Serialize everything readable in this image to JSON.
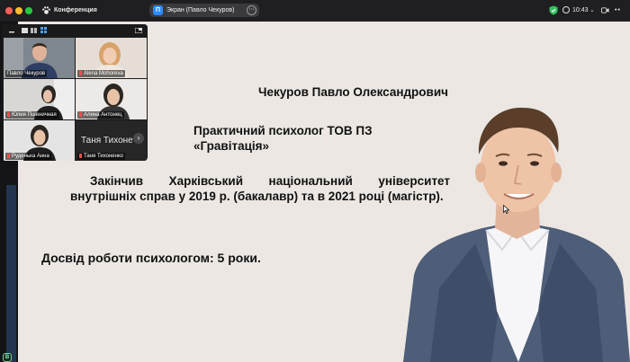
{
  "app": {
    "name": "Конференция"
  },
  "share": {
    "avatar_letter": "П",
    "label": "Экран (Павло Чекуров)",
    "menu_glyph": "⋯"
  },
  "status": {
    "time": "10:43",
    "chevron": "⌄",
    "more": "••"
  },
  "colors": {
    "slide_background": "#ece7e2",
    "active_speaker_border": "#35c164",
    "muted_mic": "#ff4d4d",
    "share_avatar": "#2d8cff"
  },
  "slide": {
    "name": "Чекуров Павло Олександрович",
    "role_line1": "Практичний психолог ТОВ ПЗ",
    "role_line2": "«Гравітація»",
    "education": "Закінчив Харківський національний університет внутрішніх справ у 2019 р. (бакалавр) та в 2021 році (магістр).",
    "experience": "Досвід роботи психологом: 5 роки."
  },
  "participants": [
    {
      "name": "Павло Чекуров",
      "muted": false,
      "active": true
    },
    {
      "name": "Alena Mohoreva",
      "muted": true,
      "active": false
    },
    {
      "name": "Юлия Пшеничная",
      "muted": true,
      "active": false
    },
    {
      "name": "Алина Антонец",
      "muted": true,
      "active": false
    },
    {
      "name": "Руденька Анна",
      "muted": true,
      "active": false
    },
    {
      "name": "Таня Тихоненко",
      "muted": true,
      "active": false,
      "display_text": "Таня Тихоне",
      "next_glyph": "›"
    }
  ],
  "icons": [
    "app-paw-icon",
    "shield-check-icon",
    "clock-icon",
    "zoom-camera-icon",
    "panel-minimize-icon",
    "panel-layout-icon",
    "grid-view-icon",
    "muted-mic-icon",
    "next-page-icon"
  ]
}
